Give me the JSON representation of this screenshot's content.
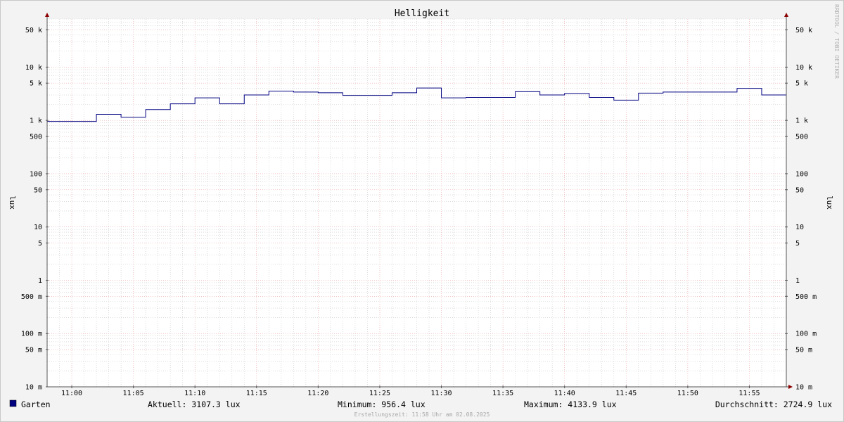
{
  "chart_data": {
    "type": "line",
    "title": "Helligkeit",
    "ylabel": "lux",
    "y_scale": "log",
    "ylim": [
      0.01,
      80000
    ],
    "xlim": [
      "10:58",
      "11:58"
    ],
    "x_ticks": [
      "11:00",
      "11:05",
      "11:10",
      "11:15",
      "11:20",
      "11:25",
      "11:30",
      "11:35",
      "11:40",
      "11:45",
      "11:50",
      "11:55"
    ],
    "y_ticks": [
      {
        "value": 50000,
        "label": "50 k"
      },
      {
        "value": 10000,
        "label": "10 k"
      },
      {
        "value": 5000,
        "label": "5 k"
      },
      {
        "value": 1000,
        "label": "1 k"
      },
      {
        "value": 500,
        "label": "500"
      },
      {
        "value": 100,
        "label": "100"
      },
      {
        "value": 50,
        "label": "50"
      },
      {
        "value": 10,
        "label": "10"
      },
      {
        "value": 5,
        "label": "5"
      },
      {
        "value": 1,
        "label": "1"
      },
      {
        "value": 0.5,
        "label": "500 m"
      },
      {
        "value": 0.1,
        "label": "100 m"
      },
      {
        "value": 0.05,
        "label": "50 m"
      },
      {
        "value": 0.01,
        "label": "10 m"
      }
    ],
    "grid": true,
    "series": [
      {
        "name": "Garten",
        "color": "#000080",
        "step": true,
        "x": [
          "10:58",
          "11:02",
          "11:04",
          "11:06",
          "11:08",
          "11:10",
          "11:12",
          "11:14",
          "11:16",
          "11:18",
          "11:20",
          "11:22",
          "11:26",
          "11:28",
          "11:30",
          "11:32",
          "11:36",
          "11:38",
          "11:40",
          "11:42",
          "11:44",
          "11:46",
          "11:48",
          "11:52",
          "11:54",
          "11:56",
          "11:58"
        ],
        "values": [
          956.4,
          1300,
          1150,
          1600,
          2050,
          2650,
          2050,
          3000,
          3550,
          3400,
          3300,
          2950,
          3300,
          4050,
          2650,
          2700,
          3450,
          3000,
          3200,
          2700,
          2400,
          3250,
          3400,
          3400,
          4000,
          3000,
          3107.3
        ]
      }
    ]
  },
  "legend": {
    "series_label": "Garten",
    "series_color": "#000080",
    "aktuell": "Aktuell: 3107.3 lux",
    "minimum": "Minimum: 956.4 lux",
    "maximum": "Maximum: 4133.9 lux",
    "durchschnitt": "Durchschnitt: 2724.9 lux"
  },
  "footer": "Erstellungszeit: 11:58 Uhr am 02.08.2025",
  "watermark": "RRDTOOL / TOBI OETIKER",
  "colors": {
    "background": "#f3f3f3",
    "plot_background": "#ffffff",
    "major_grid": "#e8a0a0",
    "minor_grid": "#c8c8c8",
    "axis": "#555555",
    "arrow": "#8b0000"
  }
}
